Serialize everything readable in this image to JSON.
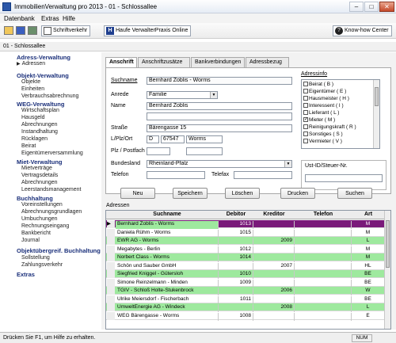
{
  "window": {
    "title": "ImmobilienVerwaltung pro 2013 - 01 - Schlossallee"
  },
  "menu": [
    "Datenbank",
    "Extras",
    "Hilfe"
  ],
  "toolbar": {
    "schriftverkehr": "Schriftverkehr",
    "haufe": "Haufe VerwalterPraxis Online",
    "knowhow": "Know-how Center"
  },
  "context_line": "01 - Schlossallee",
  "sidebar": {
    "groups": [
      {
        "label": "Adress-Verwaltung",
        "items": [
          "Adressen"
        ]
      },
      {
        "label": "Objekt-Verwaltung",
        "items": [
          "Objekte",
          "Einheiten",
          "Verbrauchsabrechnung"
        ]
      },
      {
        "label": "WEG-Verwaltung",
        "items": [
          "Wirtschaftsplan",
          "Hausgeld",
          "Abrechnungen",
          "Instandhaltung",
          "Rücklagen",
          "Beirat",
          "Eigentümerversammlung"
        ]
      },
      {
        "label": "Miet-Verwaltung",
        "items": [
          "Mietverträge",
          "Vertragsdetails",
          "Abrechnungen",
          "Leerstandsmanagement"
        ]
      },
      {
        "label": "Buchhaltung",
        "items": [
          "Voreinstellungen",
          "Abrechnungsgrundlagen",
          "Umbuchungen",
          "Rechnungseingang",
          "Bankbericht",
          "Journal"
        ]
      },
      {
        "label": "Objektübergreif. Buchhaltung",
        "items": [
          "Sollstellung",
          "Zahlungsverkehr"
        ]
      },
      {
        "label": "Extras",
        "items": []
      }
    ]
  },
  "tabs": [
    "Anschrift",
    "Anschriftzusätze",
    "Bankverbindungen",
    "Adressbezug"
  ],
  "form": {
    "suchname_label": "Suchname",
    "suchname": "Bernhard Zoblis - Worms",
    "anrede_label": "Anrede",
    "anrede": "Familie",
    "name_label": "Name",
    "name": "Bernhard Zoblis",
    "name2": "",
    "strasse_label": "Straße",
    "strasse": "Bärengasse 15",
    "lplzort_label": "L/Plz/Ort",
    "land": "D",
    "plz": "67547",
    "ort": "Worms",
    "postfach_label": "Plz / Postfach",
    "bundesland_label": "Bundesland",
    "bundesland": "Rheinland-Pfalz",
    "telefon_label": "Telefon",
    "telefax_label": "Telefax",
    "adressinfo_label": "Adressinfo",
    "adressinfo": [
      {
        "label": "Beirat ( B )",
        "checked": false
      },
      {
        "label": "Eigentümer ( E )",
        "checked": false
      },
      {
        "label": "Hausmeister ( H )",
        "checked": false
      },
      {
        "label": "Interessent ( I )",
        "checked": false
      },
      {
        "label": "Lieferant ( L )",
        "checked": false
      },
      {
        "label": "Mieter ( M )",
        "checked": true
      },
      {
        "label": "Reinigungskraft ( R )",
        "checked": false
      },
      {
        "label": "Sonstiges ( S )",
        "checked": false
      },
      {
        "label": "Vermieter ( V )",
        "checked": false
      }
    ],
    "ust_label": "Ust-ID/Steuer-Nr."
  },
  "buttons": {
    "neu": "Neu",
    "speichern": "Speichern",
    "loeschen": "Löschen",
    "drucken": "Drucken",
    "suchen": "Suchen"
  },
  "adressen": {
    "label": "Adressen",
    "columns": [
      "Suchname",
      "Debitor",
      "Kreditor",
      "Telefon",
      "Art"
    ],
    "rows": [
      {
        "suchname": "Bernhard Zoblis - Worms",
        "debitor": "1013",
        "kreditor": "",
        "telefon": "",
        "art": "M",
        "style": "selected"
      },
      {
        "suchname": "Daniela Rühm - Worms",
        "debitor": "1015",
        "kreditor": "",
        "telefon": "",
        "art": "M",
        "style": "white"
      },
      {
        "suchname": "EWR AG - Worms",
        "debitor": "",
        "kreditor": "2009",
        "telefon": "",
        "art": "L",
        "style": "green"
      },
      {
        "suchname": "Megabytes - Berlin",
        "debitor": "1012",
        "kreditor": "",
        "telefon": "",
        "art": "M",
        "style": "white"
      },
      {
        "suchname": "Norbert Class - Worms",
        "debitor": "1014",
        "kreditor": "",
        "telefon": "",
        "art": "M",
        "style": "green"
      },
      {
        "suchname": "Schön und Sauber GmbH",
        "debitor": "",
        "kreditor": "2007",
        "telefon": "",
        "art": "HL",
        "style": "white"
      },
      {
        "suchname": "Siegfried Kniggel - Gütersloh",
        "debitor": "1010",
        "kreditor": "",
        "telefon": "",
        "art": "BE",
        "style": "green"
      },
      {
        "suchname": "Simone Reinzelmann - Minden",
        "debitor": "1009",
        "kreditor": "",
        "telefon": "",
        "art": "BE",
        "style": "white"
      },
      {
        "suchname": "TGIV - Schloß Holte-Stukenbrock",
        "debitor": "",
        "kreditor": "2006",
        "telefon": "",
        "art": "W",
        "style": "green"
      },
      {
        "suchname": "Ulrike Meiersdorf - Fischerbach",
        "debitor": "1011",
        "kreditor": "",
        "telefon": "",
        "art": "BE",
        "style": "white"
      },
      {
        "suchname": "UmweltEnergie AG - Windeck",
        "debitor": "",
        "kreditor": "2008",
        "telefon": "",
        "art": "L",
        "style": "green"
      },
      {
        "suchname": "WEG Bärengasse - Worms",
        "debitor": "1008",
        "kreditor": "",
        "telefon": "",
        "art": "E",
        "style": "white"
      }
    ]
  },
  "statusbar": {
    "text": "Drücken Sie F1, um Hilfe zu erhalten.",
    "num": "NUM"
  },
  "colors": {
    "selected_row": "#7a1a7a",
    "green_row": "#9ee99e",
    "nav_group": "#1a2f7a"
  }
}
